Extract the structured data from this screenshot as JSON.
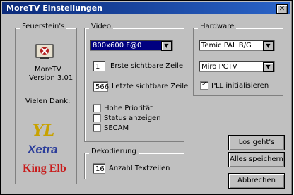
{
  "window": {
    "title": "MoreTV Einstellungen",
    "close_label": "✕"
  },
  "left": {
    "group_label": "Feuerstein's",
    "app_name": "MoreTV",
    "version": "Version 3.01",
    "thanks": "Vielen Dank:",
    "logos": {
      "yl": "YL",
      "xtra": "Xetra",
      "kingelb": "King Elb"
    }
  },
  "video": {
    "group_label": "Video",
    "resolution_selected": "800x600 F@0",
    "first_line_value": "1",
    "first_line_label": "Erste sichtbare Zeile",
    "last_line_value": "566",
    "last_line_label": "Letzte sichtbare Zeile",
    "options": [
      {
        "label": "Hohe Priorität",
        "checked": false
      },
      {
        "label": "Status anzeigen",
        "checked": false
      },
      {
        "label": "SECAM",
        "checked": false
      }
    ]
  },
  "decoding": {
    "group_label": "Dekodierung",
    "rows_value": "16",
    "rows_label": "Anzahl Textzeilen"
  },
  "hardware": {
    "group_label": "Hardware",
    "tuner_selected": "Temic PAL B/G",
    "card_selected": "Miro PCTV",
    "pll_label": "PLL initialisieren",
    "pll_checked": true
  },
  "buttons": {
    "ok": "Los geht's",
    "save": "Alles speichern",
    "cancel": "Abbrechen"
  }
}
